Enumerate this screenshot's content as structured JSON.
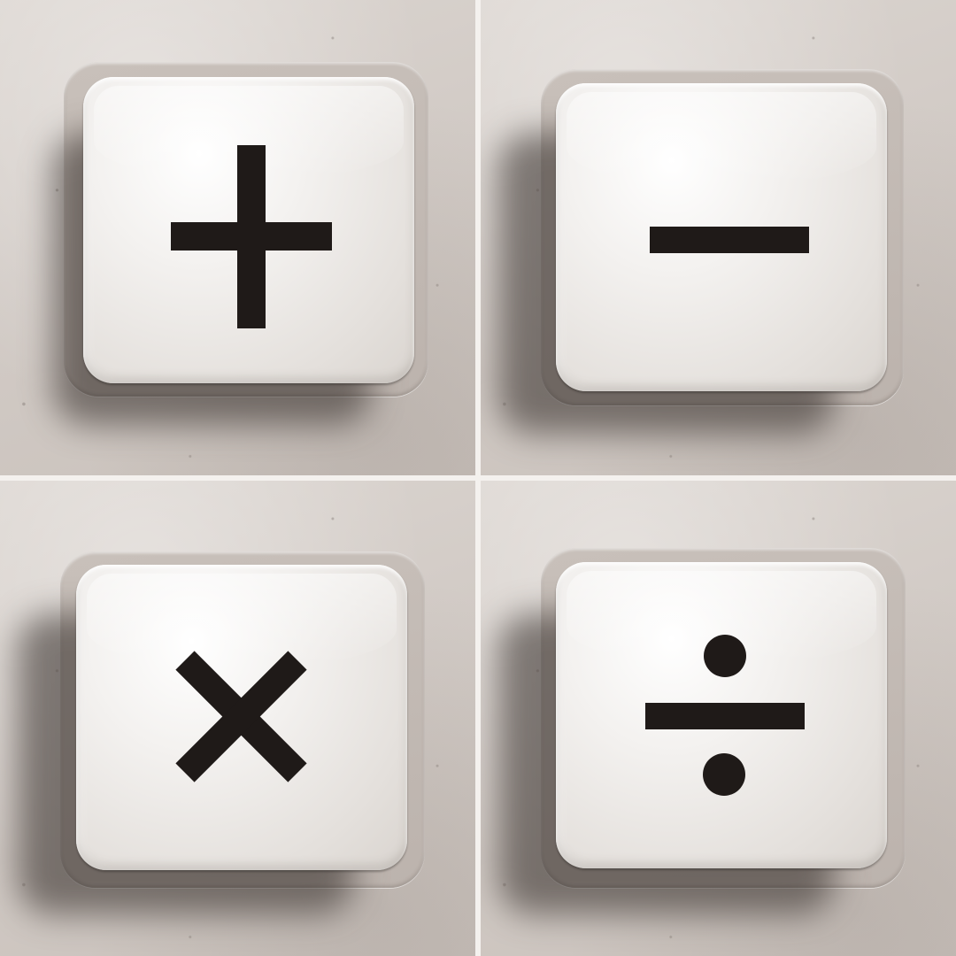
{
  "keys": [
    {
      "id": "plus",
      "symbol": "+",
      "icon": "plus-icon"
    },
    {
      "id": "minus",
      "symbol": "−",
      "icon": "minus-icon"
    },
    {
      "id": "multiply",
      "symbol": "×",
      "icon": "multiply-icon"
    },
    {
      "id": "divide",
      "symbol": "÷",
      "icon": "divide-icon"
    }
  ],
  "colors": {
    "symbol": "#1f1a18",
    "key_face": "#f1efed",
    "housing": "#d4cdc8"
  }
}
